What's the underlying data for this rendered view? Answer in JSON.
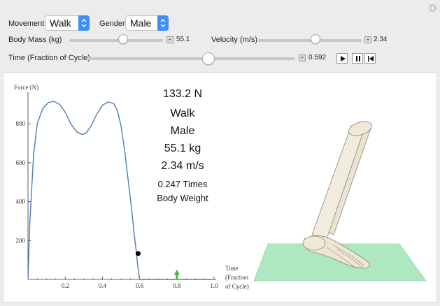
{
  "controls": {
    "movement_label": "Movement",
    "movement_value": "Walk",
    "gender_label": "Gender",
    "gender_value": "Male",
    "body_mass_label": "Body Mass (kg)",
    "body_mass_value": "55.1",
    "body_mass_fraction": 0.6,
    "velocity_label": "Velocity (m/s)",
    "velocity_value": "2.34",
    "velocity_fraction": 0.55,
    "time_label": "Time (Fraction of Cycle)",
    "time_value": "0.592",
    "time_fraction": 0.592
  },
  "info": {
    "force": "133.2 N",
    "movement": "Walk",
    "gender": "Male",
    "mass": "55.1 kg",
    "velocity": "2.34 m/s",
    "bw_line1": "0.247 Times",
    "bw_line2": "Body Weight"
  },
  "chart_data": {
    "type": "line",
    "ylabel": "Force (N)",
    "xlabel": "Time (Fraction of Cycle)",
    "xlabel_lines": [
      "Time",
      "(Fraction",
      "of Cycle)"
    ],
    "xlim": [
      0,
      1.0
    ],
    "ylim": [
      0,
      930
    ],
    "x_ticks": [
      "0.2",
      "0.4",
      "0.6",
      "0.8",
      "1.0"
    ],
    "x_tick_values": [
      0.2,
      0.4,
      0.6,
      0.8,
      1.0
    ],
    "y_ticks": [
      "200",
      "400",
      "600",
      "800"
    ],
    "y_tick_values": [
      200,
      400,
      600,
      800
    ],
    "series": [
      {
        "x": [
          0,
          0.01,
          0.03,
          0.05,
          0.08,
          0.11,
          0.14,
          0.17,
          0.2,
          0.23,
          0.26,
          0.29,
          0.31,
          0.34,
          0.37,
          0.4,
          0.43,
          0.46,
          0.48,
          0.5,
          0.52,
          0.54,
          0.555,
          0.57,
          0.58,
          0.59,
          0.6,
          0.62,
          1.0
        ],
        "y": [
          0,
          300,
          640,
          800,
          880,
          910,
          915,
          900,
          860,
          800,
          760,
          745,
          750,
          790,
          850,
          895,
          912,
          905,
          870,
          790,
          660,
          500,
          380,
          240,
          160,
          70,
          0,
          0,
          0
        ]
      }
    ],
    "current_point": {
      "x": 0.592,
      "y": 133.2
    },
    "marker_x": 0.8,
    "accent_color": "#4f7bb3",
    "marker_color": "#46b83a"
  }
}
